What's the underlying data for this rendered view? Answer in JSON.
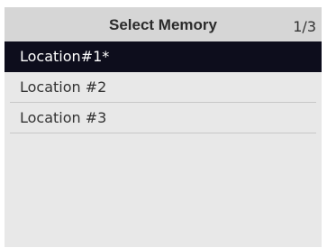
{
  "header": {
    "title": "Select Memory",
    "page_indicator": "1/3"
  },
  "list": {
    "items": [
      {
        "label": "Location#1*",
        "selected": true
      },
      {
        "label": "Location #2",
        "selected": false
      },
      {
        "label": "Location #3",
        "selected": false
      }
    ]
  },
  "colors": {
    "header_bg": "#d6d6d6",
    "panel_bg": "#e8e8e8",
    "selected_bg": "#0d0d1c",
    "selected_text": "#ffffff",
    "text": "#333333"
  }
}
